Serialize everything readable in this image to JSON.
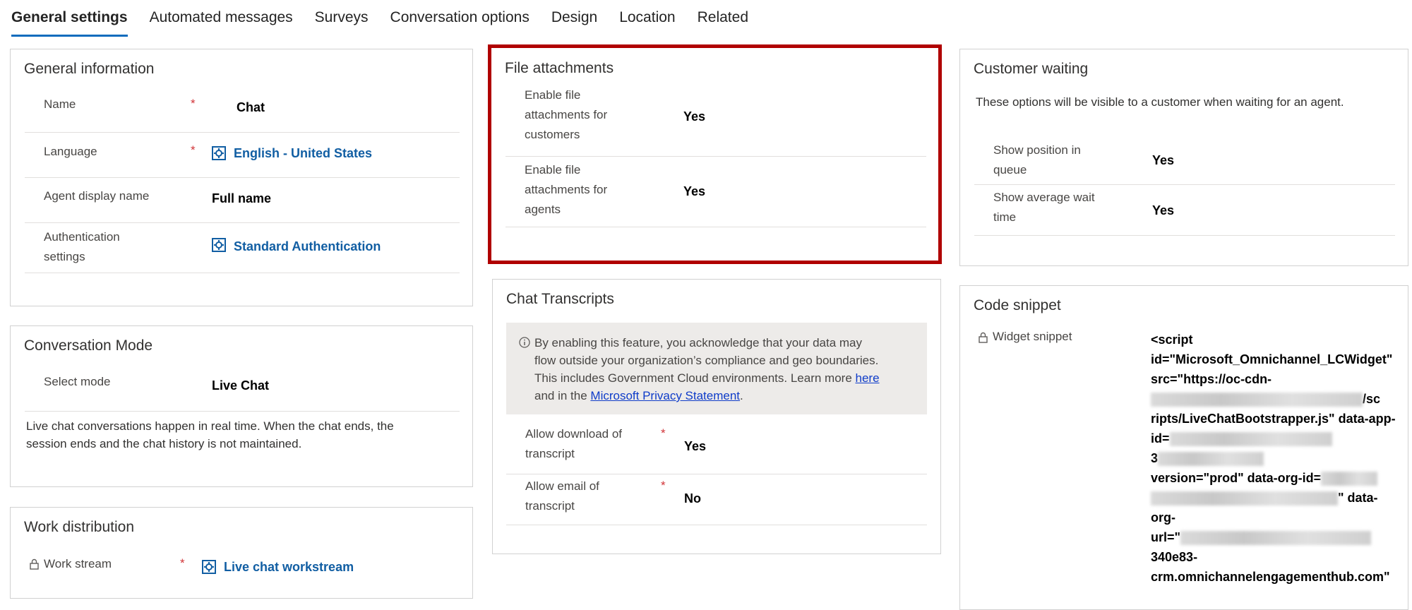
{
  "tabs": [
    {
      "label": "General settings",
      "active": true
    },
    {
      "label": "Automated messages"
    },
    {
      "label": "Surveys"
    },
    {
      "label": "Conversation options"
    },
    {
      "label": "Design"
    },
    {
      "label": "Location"
    },
    {
      "label": "Related"
    }
  ],
  "general_info": {
    "title": "General information",
    "name_label": "Name",
    "name_value": "Chat",
    "language_label": "Language",
    "language_value": "English - United States",
    "agent_display_label": "Agent display name",
    "agent_display_value": "Full name",
    "auth_label_1": "Authentication",
    "auth_label_2": "settings",
    "auth_value": "Standard Authentication",
    "required_mark": "*"
  },
  "conversation_mode": {
    "title": "Conversation Mode",
    "select_mode_label": "Select mode",
    "select_mode_value": "Live Chat",
    "description_1": "Live chat conversations happen in real time. When the chat ends, the",
    "description_2": "session ends and the chat history is not maintained."
  },
  "work_distribution": {
    "title": "Work distribution",
    "work_stream_label": "Work stream",
    "work_stream_value": "Live chat workstream"
  },
  "file_attachments": {
    "title": "File attachments",
    "customers_label_1": "Enable file",
    "customers_label_2": "attachments for",
    "customers_label_3": "customers",
    "customers_value": "Yes",
    "agents_label_1": "Enable file",
    "agents_label_2": "attachments for",
    "agents_label_3": "agents",
    "agents_value": "Yes"
  },
  "chat_transcripts": {
    "title": "Chat Transcripts",
    "banner_line_1": "By enabling this feature, you acknowledge that your data may",
    "banner_line_2": "flow outside your organization’s compliance and geo boundaries.",
    "banner_line_3": "This includes Government Cloud environments. Learn more ",
    "banner_link_here": "here",
    "banner_line_4": "and in the ",
    "banner_link_privacy": "Microsoft Privacy Statement",
    "banner_end": ".",
    "download_label_1": "Allow download of",
    "download_label_2": "transcript",
    "download_value": "Yes",
    "email_label_1": "Allow email of",
    "email_label_2": "transcript",
    "email_value": "No"
  },
  "customer_waiting": {
    "title": "Customer waiting",
    "description": "These options will be visible to a customer when waiting for an agent.",
    "position_label_1": "Show position in",
    "position_label_2": "queue",
    "position_value": "Yes",
    "wait_label_1": "Show average wait",
    "wait_label_2": "time",
    "wait_value": "Yes"
  },
  "code_snippet": {
    "title": "Code snippet",
    "widget_label": "Widget snippet",
    "line_1": "<script",
    "line_2": "id=\"Microsoft_Omnichannel_LCWidget\"",
    "line_3": "src=\"https://oc-cdn-",
    "line_4": "/sc",
    "line_5": "ripts/LiveChatBootstrapper.js\" data-app-",
    "line_6": "id=",
    "line_7": "3",
    "line_8": "version=\"prod\" data-org-id=",
    "line_9": "\" data-",
    "line_10": "org-",
    "line_11": "url=\"",
    "line_12": "340e83-",
    "line_13": "crm.omnichannelengagementhub.com\""
  },
  "colors": {
    "accent": "#0f6cbd",
    "link": "#115ea3",
    "highlight": "#b00000",
    "required": "#d13438"
  }
}
